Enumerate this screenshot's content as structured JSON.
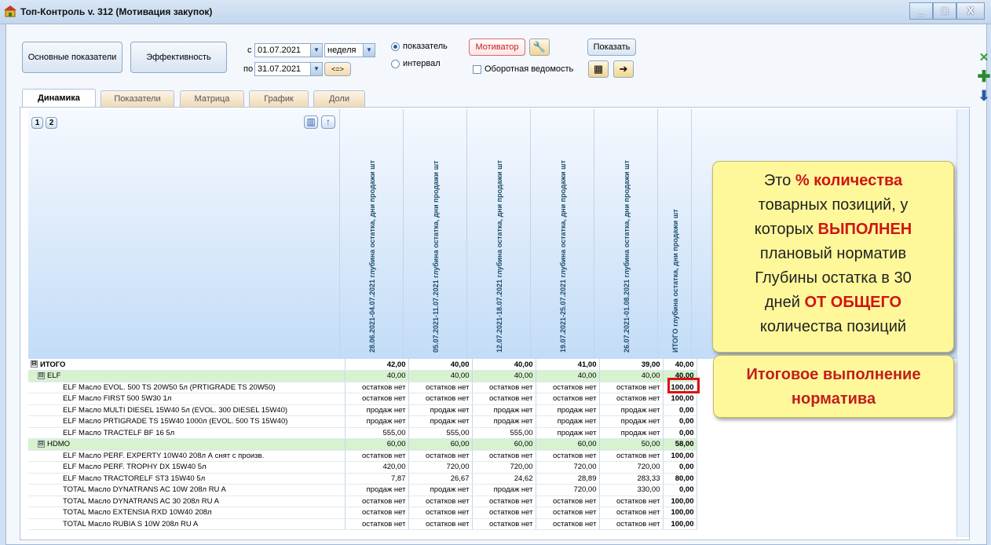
{
  "window": {
    "title": "Топ-Контроль v. 312 (Мотивация закупок)",
    "controls": [
      "_",
      "□",
      "X"
    ]
  },
  "toolbar": {
    "main_indicators_label": "Основные показатели",
    "efficiency_label": "Эффективность",
    "from_prefix": "с",
    "to_prefix": "по",
    "date_from": "01.07.2021",
    "date_to": "31.07.2021",
    "period_value": "неделя",
    "shift_label": "<=>",
    "radio_indicator_label": "показатель",
    "radio_interval_label": "интервал",
    "motivator_label": "Мотиватор",
    "show_label": "Показать",
    "turnover_sheet_label": "Оборотная ведомость"
  },
  "tabs": [
    {
      "label": "Динамика",
      "active": true
    },
    {
      "label": "Показатели",
      "active": false
    },
    {
      "label": "Матрица",
      "active": false
    },
    {
      "label": "График",
      "active": false
    },
    {
      "label": "Доли",
      "active": false
    }
  ],
  "grid": {
    "pages": [
      "1",
      "2"
    ],
    "column_headers": [
      "28.06.2021-04.07.2021 глубина остатка, дни продажи шт",
      "05.07.2021-11.07.2021 глубина остатка, дни продажи шт",
      "12.07.2021-18.07.2021 глубина остатка, дни продажи шт",
      "19.07.2021-25.07.2021 глубина остатка, дни продажи шт",
      "26.07.2021-01.08.2021 глубина остатка, дни продажи шт",
      "ИТОГО глубина остатка, дни продажи шт"
    ],
    "rows": [
      {
        "level": 0,
        "kind": "total",
        "expander": "⊟",
        "name": "ИТОГО",
        "values": [
          "42,00",
          "40,00",
          "40,00",
          "41,00",
          "39,00"
        ],
        "total": "40,00"
      },
      {
        "level": 1,
        "kind": "group",
        "expander": "⊟",
        "name": "ELF",
        "values": [
          "40,00",
          "40,00",
          "40,00",
          "40,00",
          "40,00"
        ],
        "total": "40,00"
      },
      {
        "level": 2,
        "kind": "item",
        "name": "ELF Масло EVOL. 500 TS 20W50 5л (PRTIGRADE TS 20W50)",
        "values": [
          "остатков нет",
          "остатков нет",
          "остатков нет",
          "остатков нет",
          "остатков нет"
        ],
        "total": "100,00"
      },
      {
        "level": 2,
        "kind": "item",
        "name": "ELF Масло FIRST 500 5W30 1л",
        "values": [
          "остатков нет",
          "остатков нет",
          "остатков нет",
          "остатков нет",
          "остатков нет"
        ],
        "total": "100,00"
      },
      {
        "level": 2,
        "kind": "item",
        "name": "ELF Масло MULTI DIESEL 15W40 5л (EVOL. 300 DIESEL 15W40)",
        "values": [
          "продаж нет",
          "продаж нет",
          "продаж нет",
          "продаж нет",
          "продаж нет"
        ],
        "total": "0,00"
      },
      {
        "level": 2,
        "kind": "item",
        "name": "ELF Масло PRTIGRADE TS 15W40 1000л (EVOL. 500 TS 15W40)",
        "values": [
          "продаж нет",
          "продаж нет",
          "продаж нет",
          "продаж нет",
          "продаж нет"
        ],
        "total": "0,00"
      },
      {
        "level": 2,
        "kind": "item",
        "name": "ELF Масло TRACTELF BF 16 5л",
        "values": [
          "555,00",
          "555,00",
          "555,00",
          "продаж нет",
          "продаж нет"
        ],
        "total": "0,00"
      },
      {
        "level": 1,
        "kind": "group",
        "expander": "⊟",
        "name": "HDMO",
        "values": [
          "60,00",
          "60,00",
          "60,00",
          "60,00",
          "50,00"
        ],
        "total": "58,00"
      },
      {
        "level": 2,
        "kind": "item",
        "name": "ELF Масло PERF. EXPERTY 10W40 208л   А снят с произв.",
        "values": [
          "остатков нет",
          "остатков нет",
          "остатков нет",
          "остатков нет",
          "остатков нет"
        ],
        "total": "100,00"
      },
      {
        "level": 2,
        "kind": "item",
        "name": "ELF Масло PERF. TROPHY DX 15W40 5л",
        "values": [
          "420,00",
          "720,00",
          "720,00",
          "720,00",
          "720,00"
        ],
        "total": "0,00"
      },
      {
        "level": 2,
        "kind": "item",
        "name": "ELF Масло TRACTORELF ST3 15W40 5л",
        "values": [
          "7,87",
          "26,67",
          "24,62",
          "28,89",
          "283,33"
        ],
        "total": "80,00"
      },
      {
        "level": 2,
        "kind": "item",
        "name": "TOTAL Масло DYNATRANS AC 10W 208л RU   A",
        "values": [
          "продаж нет",
          "продаж нет",
          "продаж нет",
          "720,00",
          "330,00"
        ],
        "total": "0,00"
      },
      {
        "level": 2,
        "kind": "item",
        "name": "TOTAL Масло DYNATRANS AC 30 208л RU   A",
        "values": [
          "остатков нет",
          "остатков нет",
          "остатков нет",
          "остатков нет",
          "остатков нет"
        ],
        "total": "100,00"
      },
      {
        "level": 2,
        "kind": "item",
        "name": "TOTAL Масло EXTENSIA RXD 10W40 208л",
        "values": [
          "остатков нет",
          "остатков нет",
          "остатков нет",
          "остатков нет",
          "остатков нет"
        ],
        "total": "100,00"
      },
      {
        "level": 2,
        "kind": "item",
        "name": "TOTAL Масло RUBIA S 10W 208л RU  A",
        "values": [
          "остатков нет",
          "остатков нет",
          "остатков нет",
          "остатков нет",
          "остатков нет"
        ],
        "total": "100,00"
      }
    ]
  },
  "callout_percent": {
    "lines": [
      [
        {
          "t": "Это ",
          "red": false
        },
        {
          "t": "% количества",
          "red": true
        }
      ],
      [
        {
          "t": "товарных позиций, у",
          "red": false
        }
      ],
      [
        {
          "t": "которых ",
          "red": false
        },
        {
          "t": "ВЫПОЛНЕН",
          "red": true
        }
      ],
      [
        {
          "t": "плановый норматив",
          "red": false
        }
      ],
      [
        {
          "t": "Глубины остатка в 30",
          "red": false
        }
      ],
      [
        {
          "t": "дней ",
          "red": false
        },
        {
          "t": "ОТ ОБЩЕГО",
          "red": true
        }
      ],
      [
        {
          "t": "количества позиций",
          "red": false
        }
      ]
    ]
  },
  "callout_total": {
    "line1": "Итоговое выполнение",
    "line2": "норматива"
  },
  "colors": {
    "group_row_bg": "#d7f2cf",
    "highlight_red": "#d11111",
    "callout_bg": "#fef89a"
  }
}
